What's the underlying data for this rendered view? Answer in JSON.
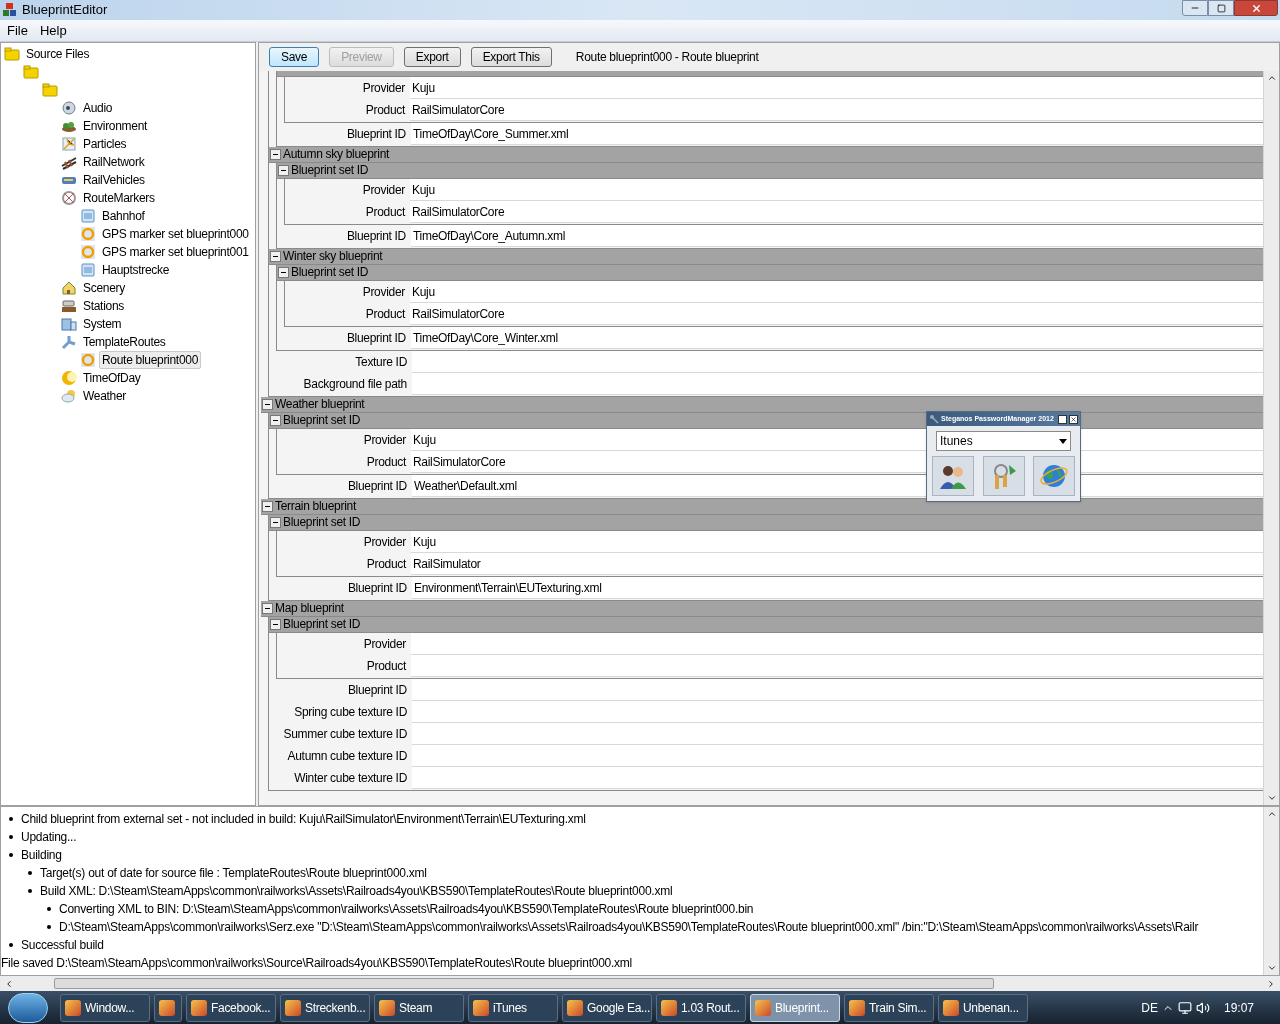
{
  "window": {
    "title": "BlueprintEditor"
  },
  "menu": [
    "File",
    "Help"
  ],
  "tree": [
    {
      "label": "Source Files",
      "kind": "folder",
      "selected": false,
      "children": [
        {
          "kind": "folder",
          "children": [
            {
              "kind": "folder",
              "children": [
                {
                  "label": "Audio",
                  "kind": "audio",
                  "selected": false
                },
                {
                  "label": "Environment",
                  "kind": "environment",
                  "selected": false
                },
                {
                  "label": "Particles",
                  "kind": "particles",
                  "selected": false
                },
                {
                  "label": "RailNetwork",
                  "kind": "railnetwork",
                  "selected": false
                },
                {
                  "label": "RailVehicles",
                  "kind": "railvehicles",
                  "selected": false
                },
                {
                  "label": "RouteMarkers",
                  "kind": "routemarkers",
                  "selected": false,
                  "children": [
                    {
                      "label": "Bahnhof",
                      "kind": "document",
                      "selected": false
                    },
                    {
                      "label": "GPS marker set blueprint000",
                      "kind": "marker",
                      "selected": false
                    },
                    {
                      "label": "GPS marker set blueprint001",
                      "kind": "marker",
                      "selected": false
                    },
                    {
                      "label": "Hauptstrecke",
                      "kind": "document",
                      "selected": false
                    }
                  ]
                },
                {
                  "label": "Scenery",
                  "kind": "scenery",
                  "selected": false
                },
                {
                  "label": "Stations",
                  "kind": "stations",
                  "selected": false
                },
                {
                  "label": "System",
                  "kind": "system",
                  "selected": false
                },
                {
                  "label": "TemplateRoutes",
                  "kind": "template",
                  "selected": false,
                  "children": [
                    {
                      "label": "Route blueprint000",
                      "kind": "marker",
                      "selected": true
                    }
                  ]
                },
                {
                  "label": "TimeOfDay",
                  "kind": "timeofday",
                  "selected": false
                },
                {
                  "label": "Weather",
                  "kind": "weather",
                  "selected": false
                }
              ]
            }
          ]
        }
      ]
    }
  ],
  "toolbar": {
    "buttons": [
      {
        "label": "Save",
        "disabled": false,
        "selected": true
      },
      {
        "label": "Preview",
        "disabled": true,
        "selected": false
      },
      {
        "label": "Export",
        "disabled": false,
        "selected": false
      },
      {
        "label": "Export This",
        "disabled": false,
        "selected": false
      }
    ],
    "caption": "Route blueprint000 - Route blueprint"
  },
  "grid": [
    {
      "kind": "group_hidden",
      "children": [
        {
          "kind": "group_hidden",
          "children": [
            {
              "kind": "group_cut",
              "children": [
                {
                  "kind": "field",
                  "label": "Provider",
                  "value": "Kuju"
                },
                {
                  "kind": "field",
                  "label": "Product",
                  "value": "RailSimulatorCore"
                }
              ]
            },
            {
              "kind": "field",
              "label": "Blueprint ID",
              "value": "TimeOfDay\\Core_Summer.xml"
            }
          ]
        },
        {
          "kind": "group",
          "label": "Autumn sky blueprint",
          "children": [
            {
              "kind": "group",
              "label": "Blueprint set ID",
              "children": [
                {
                  "kind": "field",
                  "label": "Provider",
                  "value": "Kuju"
                },
                {
                  "kind": "field",
                  "label": "Product",
                  "value": "RailSimulatorCore"
                }
              ]
            },
            {
              "kind": "field",
              "label": "Blueprint ID",
              "value": "TimeOfDay\\Core_Autumn.xml"
            }
          ]
        },
        {
          "kind": "group",
          "label": "Winter sky blueprint",
          "children": [
            {
              "kind": "group",
              "label": "Blueprint set ID",
              "children": [
                {
                  "kind": "field",
                  "label": "Provider",
                  "value": "Kuju"
                },
                {
                  "kind": "field",
                  "label": "Product",
                  "value": "RailSimulatorCore"
                }
              ]
            },
            {
              "kind": "field",
              "label": "Blueprint ID",
              "value": "TimeOfDay\\Core_Winter.xml"
            }
          ]
        },
        {
          "kind": "field",
          "label": "Texture ID"
        },
        {
          "kind": "field",
          "label": "Background file path"
        }
      ]
    },
    {
      "kind": "group",
      "label": "Weather blueprint",
      "children": [
        {
          "kind": "group",
          "label": "Blueprint set ID",
          "children": [
            {
              "kind": "field",
              "label": "Provider",
              "value": "Kuju"
            },
            {
              "kind": "field",
              "label": "Product",
              "value": "RailSimulatorCore"
            }
          ]
        },
        {
          "kind": "field",
          "label": "Blueprint ID",
          "value": "Weather\\Default.xml"
        }
      ]
    },
    {
      "kind": "group",
      "label": "Terrain blueprint",
      "children": [
        {
          "kind": "group",
          "label": "Blueprint set ID",
          "children": [
            {
              "kind": "field",
              "label": "Provider",
              "value": "Kuju"
            },
            {
              "kind": "field",
              "label": "Product",
              "value": "RailSimulator"
            }
          ]
        },
        {
          "kind": "field",
          "label": "Blueprint ID",
          "value": "Environment\\Terrain\\EUTexturing.xml"
        }
      ]
    },
    {
      "kind": "group",
      "label": "Map blueprint",
      "children": [
        {
          "kind": "group",
          "label": "Blueprint set ID",
          "children": [
            {
              "kind": "field",
              "label": "Provider"
            },
            {
              "kind": "field",
              "label": "Product"
            }
          ]
        },
        {
          "kind": "field",
          "label": "Blueprint ID"
        },
        {
          "kind": "field",
          "label": "Spring cube texture ID"
        },
        {
          "kind": "field",
          "label": "Summer cube texture ID"
        },
        {
          "kind": "field",
          "label": "Autumn cube texture ID"
        },
        {
          "kind": "field",
          "label": "Winter cube texture ID"
        }
      ]
    }
  ],
  "popup": {
    "title": "Steganos PasswordManager 2012",
    "dropdown": "Itunes"
  },
  "log": [
    {
      "kind": "bullet",
      "text": "Child blueprint from external set - not included in build: Kuju\\RailSimulator\\Environment\\Terrain\\EUTexturing.xml"
    },
    {
      "kind": "bullet",
      "text": "Updating..."
    },
    {
      "kind": "bullet",
      "text": "Building",
      "children": [
        {
          "kind": "bullet",
          "text": "Target(s) out of date for source file : TemplateRoutes\\Route blueprint000.xml"
        },
        {
          "kind": "bullet",
          "text": "Build XML: D:\\Steam\\SteamApps\\common\\railworks\\Assets\\Railroads4you\\KBS590\\TemplateRoutes\\Route blueprint000.xml",
          "children": [
            {
              "kind": "bullet",
              "text": "Converting XML to BIN: D:\\Steam\\SteamApps\\common\\railworks\\Assets\\Railroads4you\\KBS590\\TemplateRoutes\\Route blueprint000.bin"
            },
            {
              "kind": "bullet",
              "text": "D:\\Steam\\SteamApps\\common\\railworks\\Serz.exe \"D:\\Steam\\SteamApps\\common\\railworks\\Assets\\Railroads4you\\KBS590\\TemplateRoutes\\Route blueprint000.xml\" /bin:\"D:\\Steam\\SteamApps\\common\\railworks\\Assets\\Railr"
            }
          ]
        }
      ]
    },
    {
      "kind": "bullet",
      "text": "Successful build"
    },
    {
      "kind": "plain",
      "text": "File saved D:\\Steam\\SteamApps\\common\\railworks\\Source\\Railroads4you\\KBS590\\TemplateRoutes\\Route blueprint000.xml"
    }
  ],
  "taskbar": {
    "items": [
      {
        "label": "Window...",
        "selected": false
      },
      {
        "kind": "icon_only",
        "selected": false
      },
      {
        "label": "Facebook...",
        "selected": false
      },
      {
        "label": "Streckenb...",
        "selected": false
      },
      {
        "label": "Steam",
        "selected": false
      },
      {
        "label": "iTunes",
        "selected": false
      },
      {
        "label": "Google Ea...",
        "selected": false
      },
      {
        "label": "1.03 Rout...",
        "selected": false
      },
      {
        "label": "Blueprint...",
        "selected": true
      },
      {
        "label": "Train Sim...",
        "selected": false
      },
      {
        "label": "Unbenan...",
        "selected": false
      }
    ],
    "language": "DE",
    "clock": "19:07"
  }
}
